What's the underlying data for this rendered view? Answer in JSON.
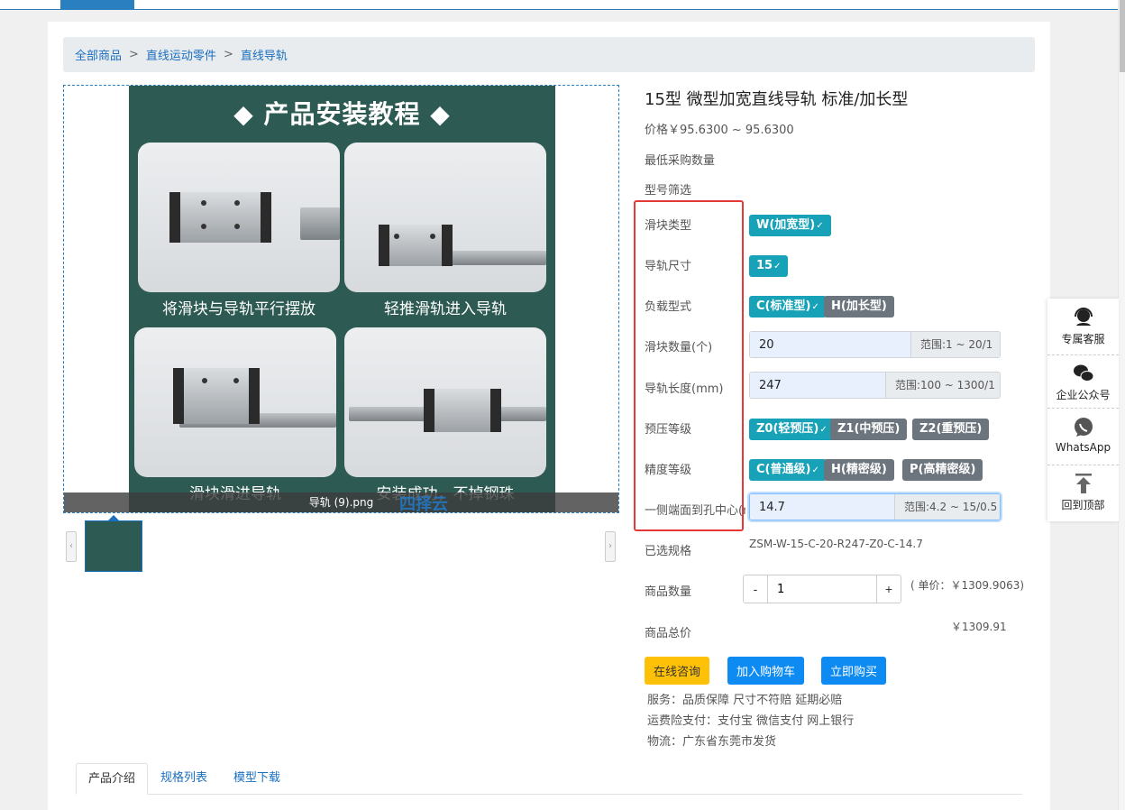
{
  "breadcrumb": {
    "items": [
      "全部商品",
      "直线运动零件",
      "直线导轨"
    ],
    "sep": ">"
  },
  "gallery": {
    "poster_title": "◆ 产品安装教程 ◆",
    "captions": [
      "将滑块与导轨平行摆放",
      "轻推滑轨进入导轨",
      "滑块滑进导轨",
      "安装成功，不掉钢珠"
    ],
    "image_name": "导轨 (9).png",
    "watermark": "四择云",
    "prev_arrow": "‹",
    "next_arrow": "›"
  },
  "product": {
    "title": "15型 微型加宽直线导轨 标准/加长型",
    "price": "价格￥95.6300 ~ 95.6300",
    "min_order_label": "最低采购数量",
    "model_filter_label": "型号筛选"
  },
  "options": {
    "slider_type": {
      "label": "滑块类型",
      "choices": [
        "W(加宽型)"
      ]
    },
    "rail_size": {
      "label": "导轨尺寸",
      "choices": [
        "15"
      ]
    },
    "load_type": {
      "label": "负载型式",
      "choices": [
        "C(标准型)",
        "H(加长型)"
      ]
    },
    "slider_count": {
      "label": "滑块数量(个)",
      "value": "20",
      "range": "范围:1 ~ 20/1"
    },
    "rail_length": {
      "label": "导轨长度(mm)",
      "value": "247",
      "range": "范围:100 ~ 1300/1"
    },
    "preload": {
      "label": "预压等级",
      "choices": [
        "Z0(轻预压)",
        "Z1(中预压)",
        "Z2(重预压)"
      ]
    },
    "precision": {
      "label": "精度等级",
      "choices": [
        "C(普通级)",
        "H(精密级)",
        "P(高精密级)"
      ]
    },
    "end_to_hole": {
      "label": "一侧端面到孔中心(mm)",
      "value": "14.7",
      "range": "范围:4.2 ~ 15/0.5"
    },
    "check": "✓"
  },
  "selected_spec": {
    "label": "已选规格",
    "value": "ZSM-W-15-C-20-R247-Z0-C-14.7"
  },
  "quantity": {
    "label": "商品数量",
    "minus": "-",
    "plus": "+",
    "value": "1",
    "unit_price": "( 单价：￥1309.9063)"
  },
  "total": {
    "label": "商品总价",
    "value": "￥1309.91"
  },
  "buttons": {
    "consult": "在线咨询",
    "cart": "加入购物车",
    "buy": "立即购买"
  },
  "info": {
    "service": "服务：品质保障 尺寸不符赔 延期必赔",
    "insurance": "运费险支付：支付宝 微信支付 网上银行",
    "logistics": "物流：广东省东莞市发货"
  },
  "tabs": [
    "产品介绍",
    "规格列表",
    "模型下载"
  ],
  "float_panel": {
    "items": [
      "专属客服",
      "企业公众号",
      "WhatsApp",
      "回到顶部"
    ]
  },
  "colors": {
    "selected_option": "#17a2b8",
    "unselected_option": "#6c757d",
    "consult": "#ffc107",
    "primary": "#0d8bf2",
    "highlight_box": "#e53935",
    "poster_bg": "#2d5a52"
  }
}
